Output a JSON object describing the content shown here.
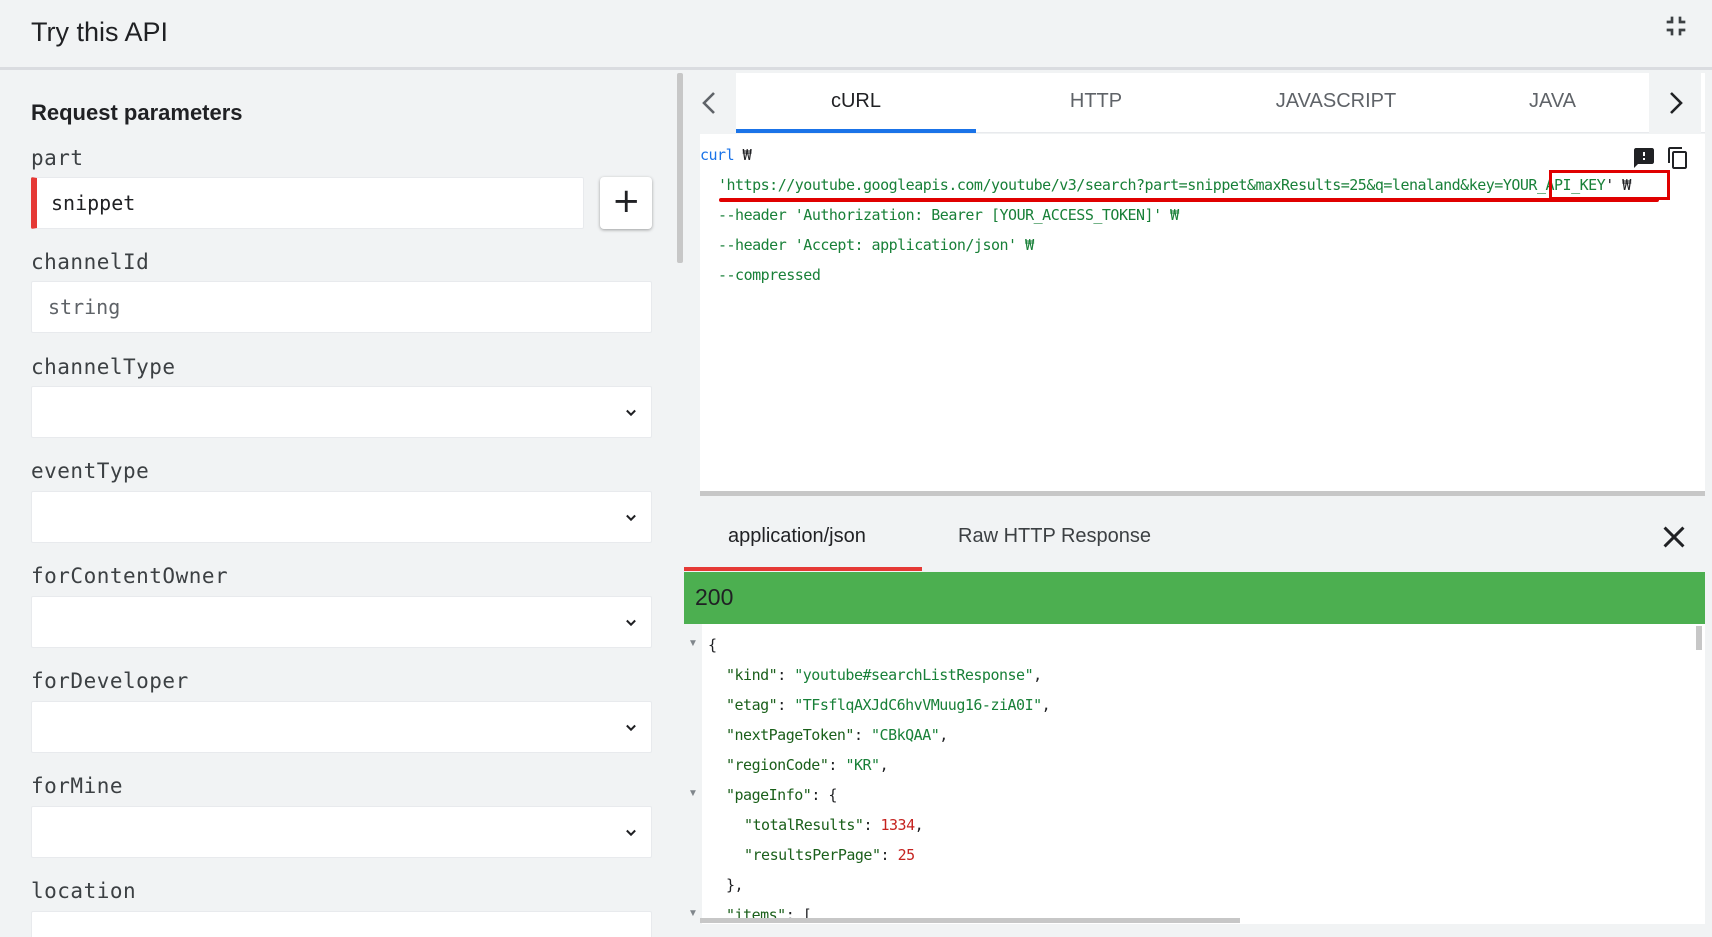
{
  "header": {
    "title": "Try this API"
  },
  "params": {
    "section_title": "Request parameters",
    "part": {
      "label": "part",
      "value": "snippet"
    },
    "channelId": {
      "label": "channelId",
      "placeholder": "string"
    },
    "channelType": {
      "label": "channelType",
      "value": ""
    },
    "eventType": {
      "label": "eventType",
      "value": ""
    },
    "forContentOwner": {
      "label": "forContentOwner",
      "value": ""
    },
    "forDeveloper": {
      "label": "forDeveloper",
      "value": ""
    },
    "forMine": {
      "label": "forMine",
      "value": ""
    },
    "location": {
      "label": "location"
    }
  },
  "code_tabs": [
    "cURL",
    "HTTP",
    "JAVASCRIPT",
    "JAVA"
  ],
  "active_code_tab": "cURL",
  "code": {
    "line1_cmd": "curl",
    "line1_cont": " ₩",
    "line2_open": "'",
    "line2_url": "https://youtube.googleapis.com/youtube/v3/search?part=snippet&maxResults=25&q=lenaland&key=",
    "line2_key": "YOUR_API_KEY",
    "line2_close": "' ₩",
    "line3": "--header 'Authorization: Bearer [YOUR_ACCESS_TOKEN]' ₩",
    "line4": "--header 'Accept: application/json' ₩",
    "line5": "--compressed"
  },
  "response": {
    "tabs": [
      "application/json",
      "Raw HTTP Response"
    ],
    "status": "200",
    "json": {
      "open": "{",
      "kind_key": "\"kind\"",
      "kind_val": "\"youtube#searchListResponse\"",
      "etag_key": "\"etag\"",
      "etag_val": "\"TFsflqAXJdC6hvVMuug16-ziA0I\"",
      "npt_key": "\"nextPageToken\"",
      "npt_val": "\"CBkQAA\"",
      "region_key": "\"regionCode\"",
      "region_val": "\"KR\"",
      "pageinfo_key": "\"pageInfo\"",
      "total_key": "\"totalResults\"",
      "total_val": "1334",
      "rpp_key": "\"resultsPerPage\"",
      "rpp_val": "25",
      "close_obj": "},",
      "items_key": "\"items\"",
      "items_open": "["
    }
  },
  "colors": {
    "status_ok": "#4caf50",
    "accent_blue": "#1a73e8",
    "required_red": "#e53935",
    "highlight_red": "#e00000"
  }
}
